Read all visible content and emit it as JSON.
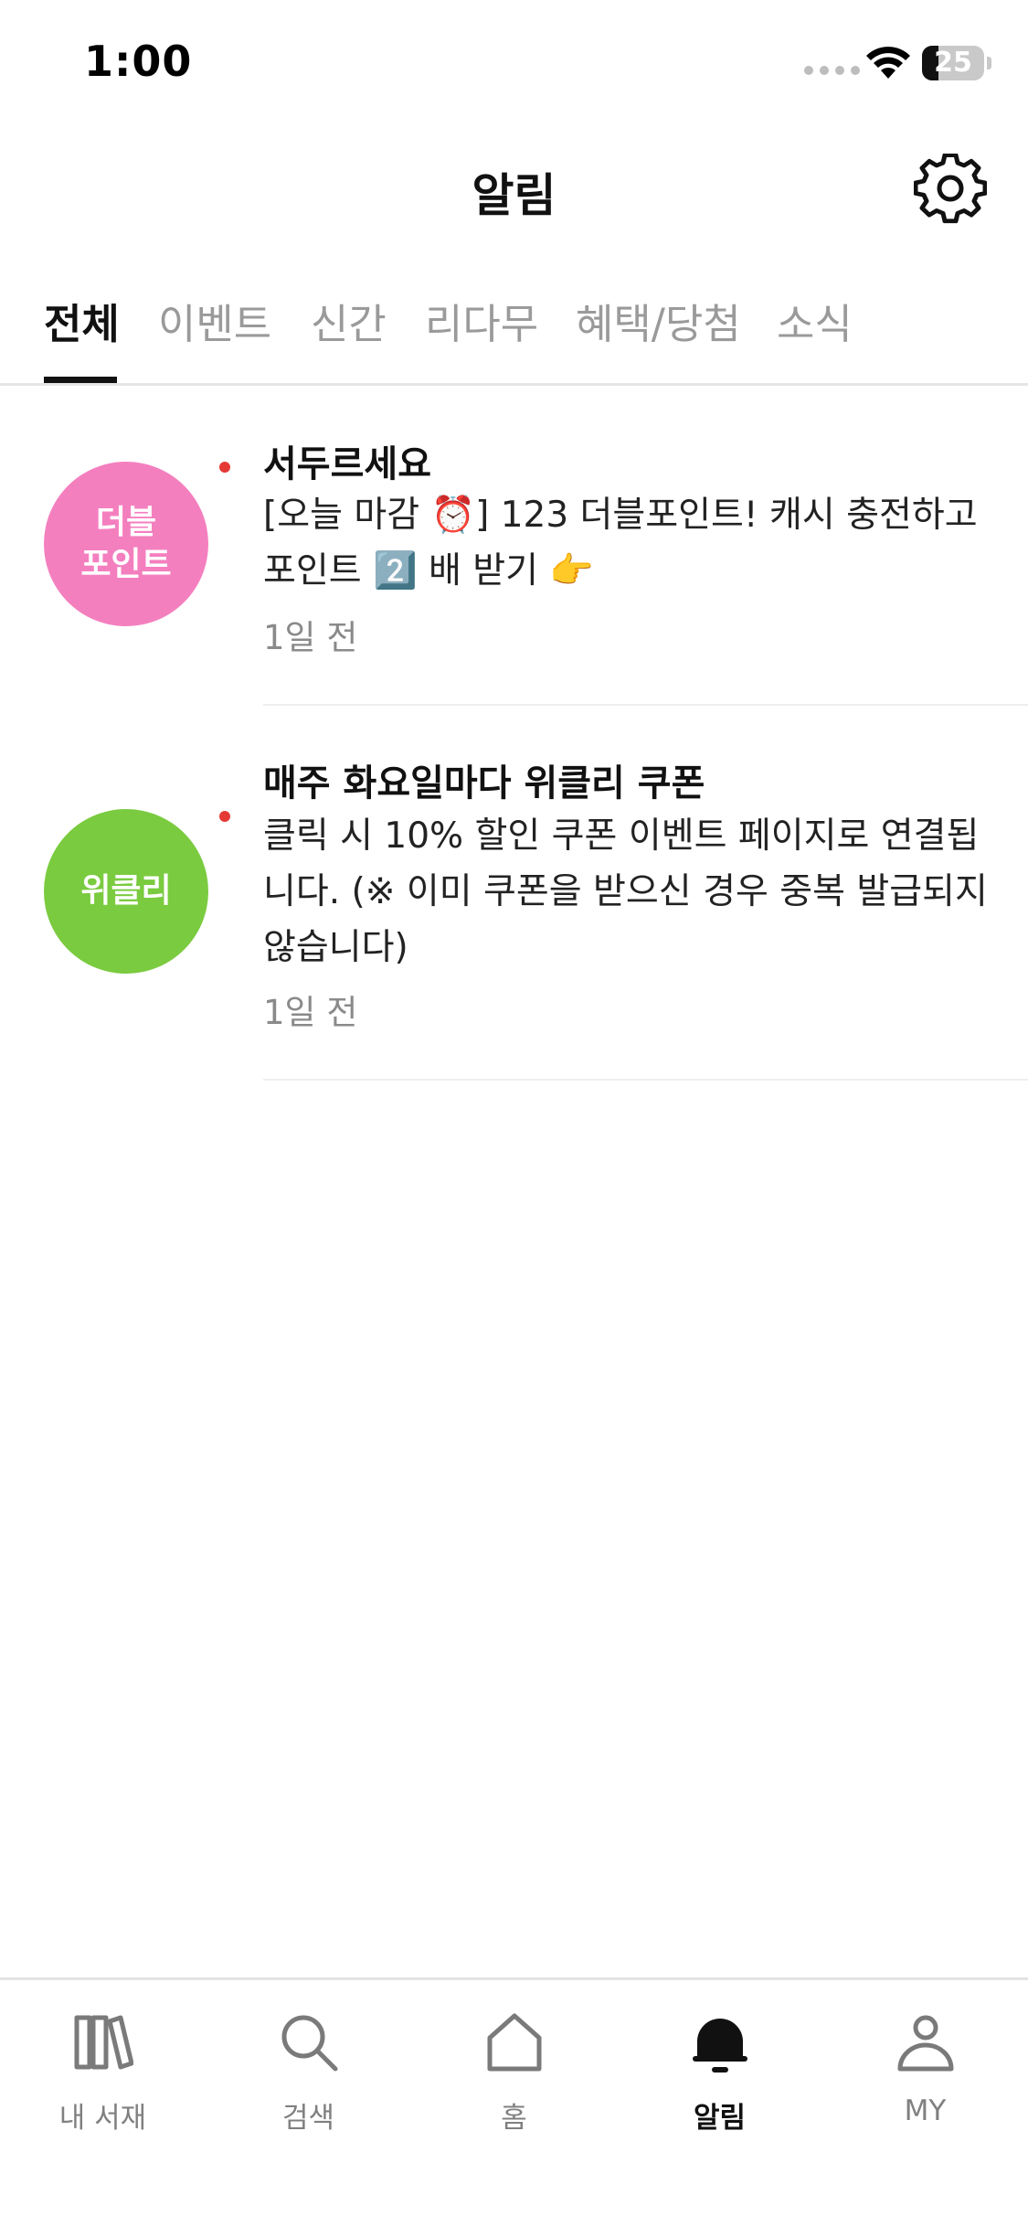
{
  "status_bar": {
    "time": "1:00",
    "battery": "25"
  },
  "header": {
    "title": "알림",
    "settings_icon": "gear-icon"
  },
  "tabs": [
    {
      "label": "전체",
      "active": true
    },
    {
      "label": "이벤트",
      "active": false
    },
    {
      "label": "신간",
      "active": false
    },
    {
      "label": "리다무",
      "active": false
    },
    {
      "label": "혜택/당첨",
      "active": false
    },
    {
      "label": "소식",
      "active": false
    }
  ],
  "notifications": [
    {
      "avatar_text": "더블\n포인트",
      "avatar_color": "#F47FBF",
      "unread": true,
      "title": "서두르세요",
      "body": "[오늘 마감 ⏰] 123 더블포인트! 캐시 충전하고 포인트 2️⃣ 배 받기 👉",
      "time": "1일 전"
    },
    {
      "avatar_text": "위클리",
      "avatar_color": "#7ACB3F",
      "unread": true,
      "title": "매주 화요일마다 위클리 쿠폰",
      "body": "클릭 시 10% 할인 쿠폰 이벤트 페이지로 연결됩니다. (※ 이미 쿠폰을 받으신 경우 중복 발급되지 않습니다)",
      "time": "1일 전"
    }
  ],
  "bottom_nav": [
    {
      "label": "내 서재",
      "icon": "library-icon",
      "active": false
    },
    {
      "label": "검색",
      "icon": "search-icon",
      "active": false
    },
    {
      "label": "홈",
      "icon": "home-icon",
      "active": false
    },
    {
      "label": "알림",
      "icon": "bell-icon",
      "active": true
    },
    {
      "label": "MY",
      "icon": "user-icon",
      "active": false
    }
  ],
  "colors": {
    "unread_dot": "#E53935",
    "active_text": "#111111",
    "inactive_text": "#9A9A9A"
  }
}
